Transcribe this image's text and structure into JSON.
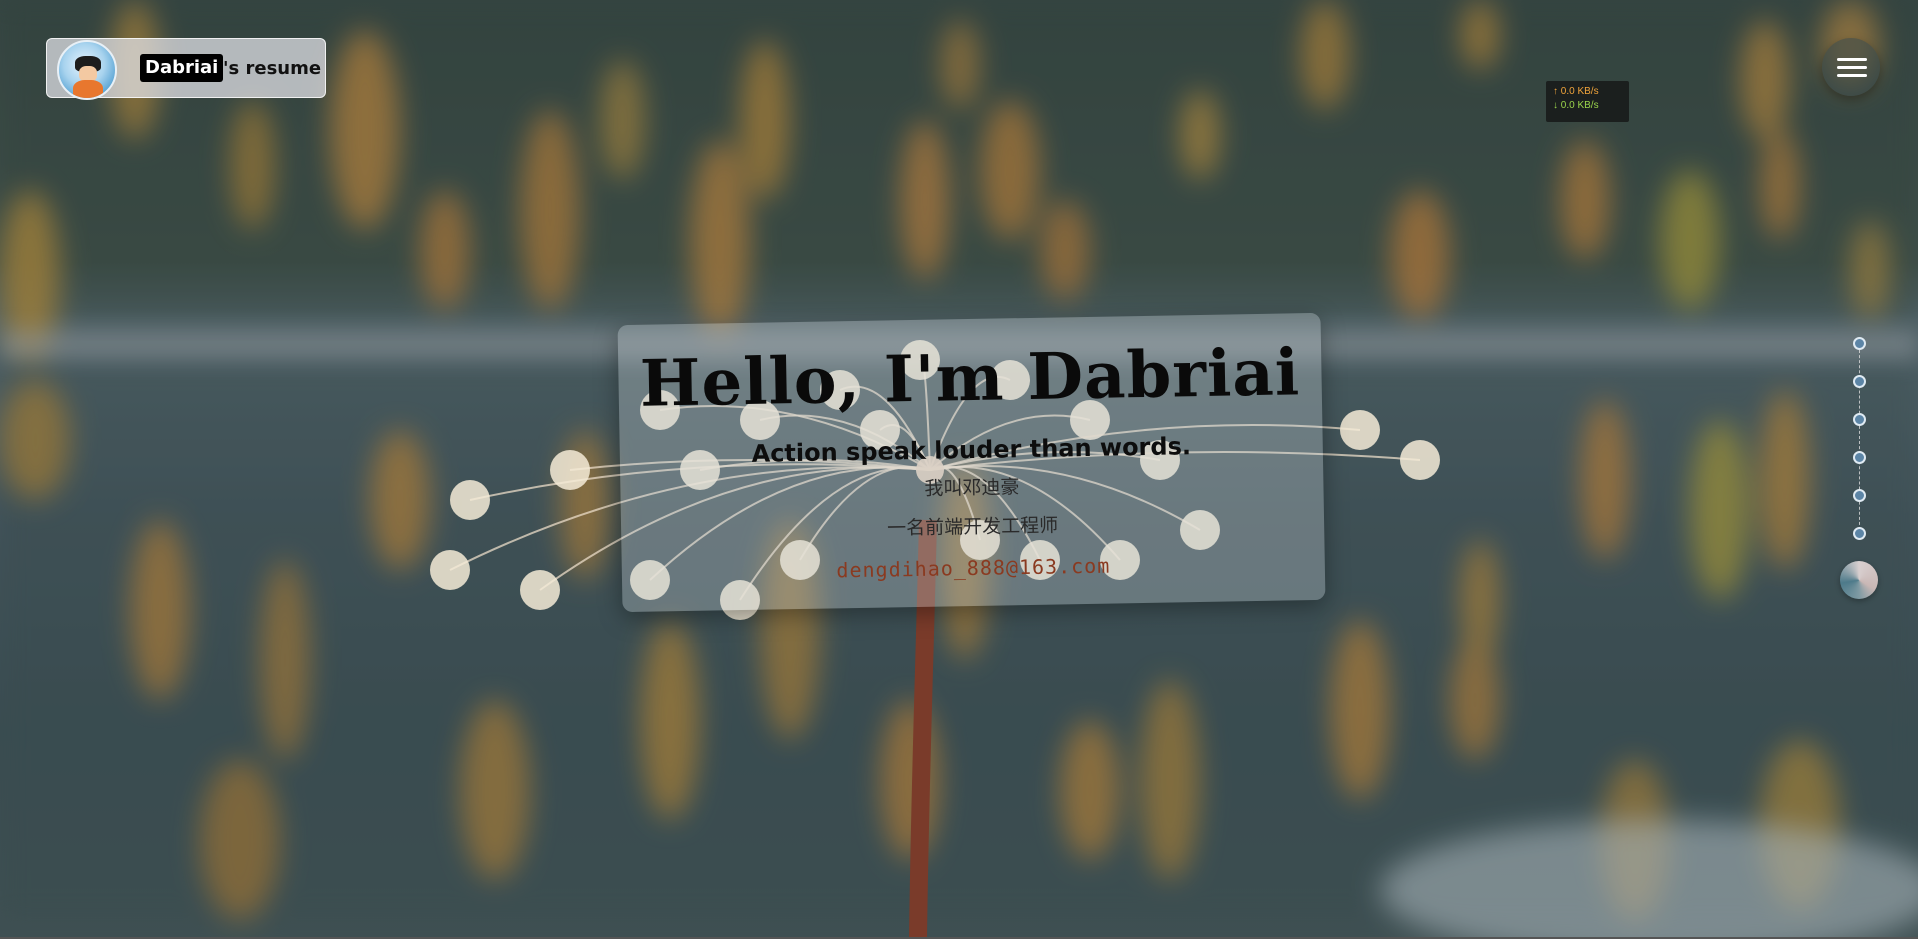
{
  "header": {
    "brand_name": "Dabriai",
    "brand_suffix": "'s resume",
    "avatar_icon": "goku-avatar-icon"
  },
  "netspeed": {
    "upload": "↑ 0.0 KB/s",
    "download": "↓ 0.0 KB/s",
    "upload_color": "#f0a43b",
    "download_color": "#9ad44b"
  },
  "menu": {
    "icon": "hamburger-menu-icon"
  },
  "intro": {
    "title": "Hello, I'm Dabriai",
    "motto": "Action speak louder than words.",
    "name_line": "我叫邓迪豪",
    "role_line": "一名前端开发工程师",
    "email": "dengdihao_888@163.com",
    "email_color": "#8a3a20"
  },
  "section_nav": {
    "dot_count": 6,
    "toggle_icon": "theme-toggle-icon"
  }
}
